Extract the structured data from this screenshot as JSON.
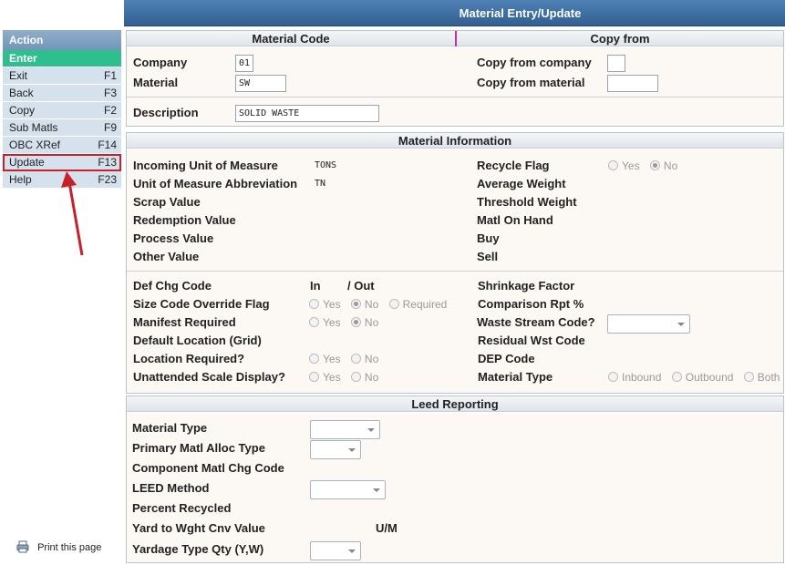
{
  "window": {
    "title": "Material Entry/Update"
  },
  "action_panel": {
    "header": "Action",
    "items": [
      {
        "label": "Enter",
        "key": ""
      },
      {
        "label": "Exit",
        "key": "F1"
      },
      {
        "label": "Back",
        "key": "F3"
      },
      {
        "label": "Copy",
        "key": "F2"
      },
      {
        "label": "Sub Matls",
        "key": "F9"
      },
      {
        "label": "OBC XRef",
        "key": "F14"
      },
      {
        "label": "Update",
        "key": "F13"
      },
      {
        "label": "Help",
        "key": "F23"
      }
    ],
    "print_label": "Print this page"
  },
  "material_code": {
    "header_left": "Material Code",
    "header_right": "Copy from",
    "company_label": "Company",
    "company_value": "01",
    "material_label": "Material",
    "material_value": "SW",
    "description_label": "Description",
    "description_value": "SOLID WASTE",
    "copy_company_label": "Copy from company",
    "copy_company_value": "",
    "copy_material_label": "Copy from material",
    "copy_material_value": ""
  },
  "material_info": {
    "header": "Material Information",
    "incoming_uom_label": "Incoming Unit of Measure",
    "incoming_uom_value": "TONS",
    "uom_abbrev_label": "Unit of Measure Abbreviation",
    "uom_abbrev_value": "TN",
    "scrap_value_label": "Scrap Value",
    "redemption_value_label": "Redemption Value",
    "process_value_label": "Process Value",
    "other_value_label": "Other Value",
    "recycle_flag_label": "Recycle Flag",
    "recycle_yes": "Yes",
    "recycle_no": "No",
    "average_weight_label": "Average Weight",
    "threshold_weight_label": "Threshold Weight",
    "matl_on_hand_label": "Matl On Hand",
    "buy_label": "Buy",
    "sell_label": "Sell",
    "def_chg_code_label": "Def Chg Code",
    "in_label": "In",
    "out_label": "/ Out",
    "size_code_label": "Size Code Override Flag",
    "size_yes": "Yes",
    "size_no": "No",
    "size_required": "Required",
    "manifest_label": "Manifest Required",
    "manifest_yes": "Yes",
    "manifest_no": "No",
    "default_location_label": "Default Location (Grid)",
    "location_required_label": "Location Required?",
    "location_yes": "Yes",
    "location_no": "No",
    "unattended_label": "Unattended Scale Display?",
    "unattended_yes": "Yes",
    "unattended_no": "No",
    "shrinkage_label": "Shrinkage Factor",
    "comparison_label": "Comparison Rpt %",
    "waste_stream_label": "Waste Stream Code?",
    "residual_label": "Residual Wst Code",
    "dep_code_label": "DEP Code",
    "material_type_label": "Material Type",
    "mt_inbound": "Inbound",
    "mt_outbound": "Outbound",
    "mt_both": "Both"
  },
  "leed": {
    "header": "Leed Reporting",
    "material_type_label": "Material Type",
    "primary_alloc_label": "Primary Matl Alloc Type",
    "component_chg_label": "Component Matl Chg Code",
    "leed_method_label": "LEED Method",
    "percent_recycled_label": "Percent Recycled",
    "yard_to_wght_label": "Yard to Wght Cnv Value",
    "um_label": "U/M",
    "yardage_type_label": "Yardage Type Qty (Y,W)"
  },
  "colors": {
    "title_bar": "#3d6da0",
    "active_action": "#2fbf8f",
    "highlight": "#c8202a"
  }
}
